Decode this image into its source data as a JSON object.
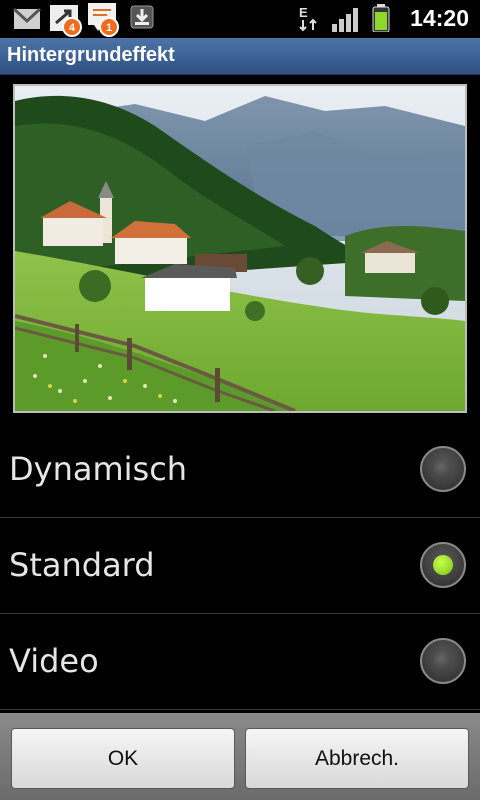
{
  "status_bar": {
    "icons": [
      "gmail-icon",
      "missed-call-icon",
      "messages-icon",
      "download-icon",
      "edge-signal-icon",
      "signal-bars-icon",
      "battery-icon"
    ],
    "missed_call_badge": "4",
    "messages_badge": "1",
    "network_type": "E",
    "time": "14:20"
  },
  "dialog": {
    "title": "Hintergrundeffekt",
    "options": [
      {
        "label": "Dynamisch",
        "selected": false
      },
      {
        "label": "Standard",
        "selected": true
      },
      {
        "label": "Video",
        "selected": false
      }
    ],
    "ok_label": "OK",
    "cancel_label": "Abbrech."
  },
  "colors": {
    "title_bar": "#3b5f92",
    "radio_selected": "#8fd82a",
    "badge": "#f26b1d"
  }
}
